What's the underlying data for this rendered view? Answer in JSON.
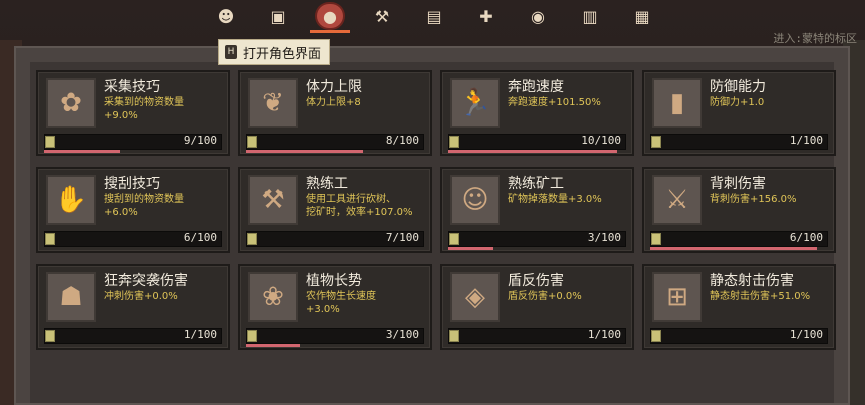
{
  "colors": {
    "progress": "#d2666f",
    "desc_text": "#e0c558",
    "panel_bg": "#3c3634"
  },
  "background": {
    "right_text": "进入:蒙特的标区"
  },
  "toolbar": [
    {
      "name": "character-icon",
      "glyph": "☻",
      "active": false
    },
    {
      "name": "bag-icon",
      "glyph": "▣",
      "active": false
    },
    {
      "name": "skill-orb-icon",
      "glyph": "●",
      "active": true
    },
    {
      "name": "tool-icon",
      "glyph": "⚒",
      "active": false
    },
    {
      "name": "map-icon",
      "glyph": "▤",
      "active": false
    },
    {
      "name": "add-user-icon",
      "glyph": "✚",
      "active": false
    },
    {
      "name": "coin-icon",
      "glyph": "◉",
      "active": false
    },
    {
      "name": "book-icon",
      "glyph": "▥",
      "active": false
    },
    {
      "name": "stats-icon",
      "glyph": "▦",
      "active": false
    }
  ],
  "tooltip": {
    "key": "H",
    "text": "打开角色界面"
  },
  "skills": [
    {
      "title": "采集技巧",
      "desc": "采集到的物资数量\n+9.0%",
      "count": "9/100",
      "progress": 0.42,
      "icon": "flower-icon",
      "glyph": "✿"
    },
    {
      "title": "体力上限",
      "desc": "体力上限+8",
      "count": "8/100",
      "progress": 0.65,
      "icon": "lungs-icon",
      "glyph": "❦"
    },
    {
      "title": "奔跑速度",
      "desc": "奔跑速度+101.50%",
      "count": "10/100",
      "progress": 0.94,
      "icon": "runner-icon",
      "glyph": "🏃"
    },
    {
      "title": "防御能力",
      "desc": "防御力+1.0",
      "count": "1/100",
      "progress": 0,
      "icon": "shield-icon",
      "glyph": "▮"
    },
    {
      "title": "搜刮技巧",
      "desc": "搜刮到的物资数量\n+6.0%",
      "count": "6/100",
      "progress": 0,
      "icon": "hand-icon",
      "glyph": "✋"
    },
    {
      "title": "熟练工",
      "desc": "使用工具进行砍树、\n挖矿时，效率+107.0%",
      "count": "7/100",
      "progress": 0,
      "icon": "axe-icon",
      "glyph": "⚒"
    },
    {
      "title": "熟练矿工",
      "desc": "矿物掉落数量+3.0%",
      "count": "3/100",
      "progress": 0.25,
      "icon": "miner-icon",
      "glyph": "☺"
    },
    {
      "title": "背刺伤害",
      "desc": "背刺伤害+156.0%",
      "count": "6/100",
      "progress": 0.93,
      "icon": "backstab-icon",
      "glyph": "⚔"
    },
    {
      "title": "狂奔突袭伤害",
      "desc": "冲刺伤害+0.0%",
      "count": "1/100",
      "progress": 0,
      "icon": "silhouette-icon",
      "glyph": "☗"
    },
    {
      "title": "植物长势",
      "desc": "农作物生长速度\n+3.0%",
      "count": "3/100",
      "progress": 0.3,
      "icon": "plant-pot-icon",
      "glyph": "❀"
    },
    {
      "title": "盾反伤害",
      "desc": "盾反伤害+0.0%",
      "count": "1/100",
      "progress": 0,
      "icon": "parry-shield-icon",
      "glyph": "◈"
    },
    {
      "title": "静态射击伤害",
      "desc": "静态射击伤害+51.0%",
      "count": "1/100",
      "progress": 0,
      "icon": "target-icon",
      "glyph": "⊞"
    }
  ]
}
